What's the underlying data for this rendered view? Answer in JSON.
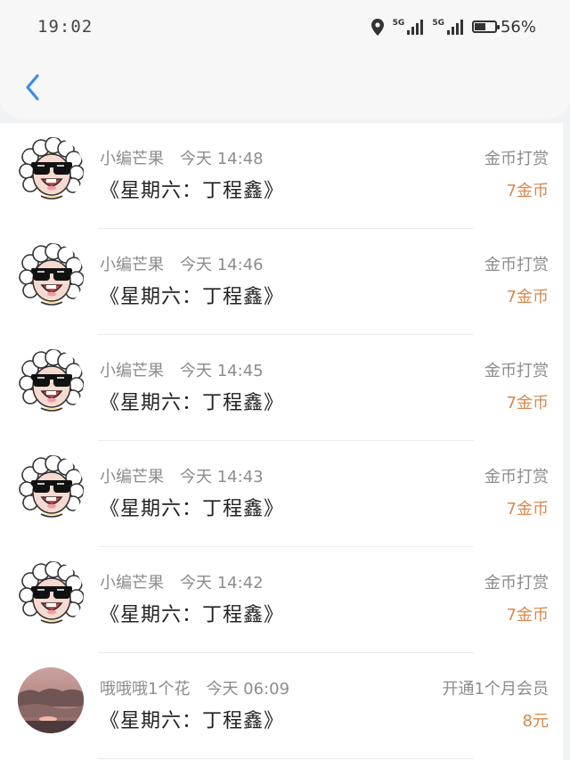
{
  "status_bar": {
    "time": "19:02",
    "network_1": "5G",
    "network_2": "5G",
    "battery_percent": "56%",
    "battery_level": 0.56
  },
  "header": {
    "back_icon": "chevron-left-icon",
    "accent_color": "#3a8ee6"
  },
  "items": [
    {
      "name": "小编芒果",
      "time": "今天 14:48",
      "title": "《星期六：丁程鑫》",
      "action": "金币打赏",
      "amount": "7金币",
      "avatar": "cartoon-sheep-sunglasses"
    },
    {
      "name": "小编芒果",
      "time": "今天 14:46",
      "title": "《星期六：丁程鑫》",
      "action": "金币打赏",
      "amount": "7金币",
      "avatar": "cartoon-sheep-sunglasses"
    },
    {
      "name": "小编芒果",
      "time": "今天 14:45",
      "title": "《星期六：丁程鑫》",
      "action": "金币打赏",
      "amount": "7金币",
      "avatar": "cartoon-sheep-sunglasses"
    },
    {
      "name": "小编芒果",
      "time": "今天 14:43",
      "title": "《星期六：丁程鑫》",
      "action": "金币打赏",
      "amount": "7金币",
      "avatar": "cartoon-sheep-sunglasses"
    },
    {
      "name": "小编芒果",
      "time": "今天 14:42",
      "title": "《星期六：丁程鑫》",
      "action": "金币打赏",
      "amount": "7金币",
      "avatar": "cartoon-sheep-sunglasses"
    },
    {
      "name": "哦哦哦1个花",
      "time": "今天 06:09",
      "title": "《星期六：丁程鑫》",
      "action": "开通1个月会员",
      "amount": "8元",
      "avatar": "sunset-photo"
    }
  ],
  "colors": {
    "amount": "#d9884a",
    "muted_text": "#8c8c8c",
    "background": "#f1f2f4"
  }
}
